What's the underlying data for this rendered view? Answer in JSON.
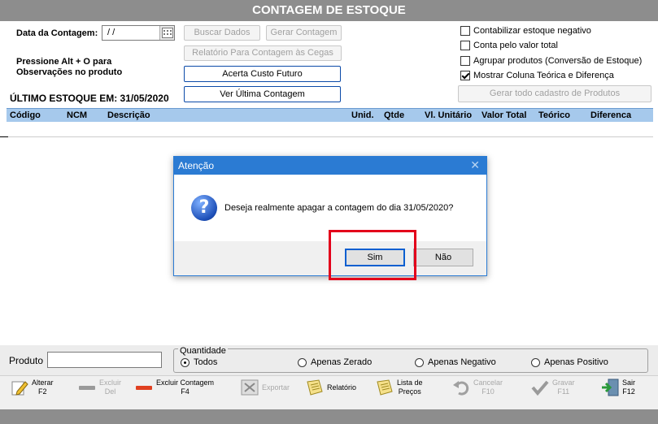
{
  "window": {
    "title": "CONTAGEM DE ESTOQUE"
  },
  "header": {
    "date_label": "Data da Contagem:",
    "date_value": "/ /",
    "hint_line1": "Pressione Alt + O para",
    "hint_line2": "Observações no produto",
    "last_stock": "ÚLTIMO ESTOQUE EM: 31/05/2020"
  },
  "buttons": {
    "buscar": "Buscar Dados",
    "gerar": "Gerar Contagem",
    "relatorio_cegas": "Relatório Para Contagem às Cegas",
    "acerta_custo": "Acerta Custo Futuro",
    "ver_ultima": "Ver Última Contagem",
    "gerar_cadastro": "Gerar todo cadastro de Produtos"
  },
  "options": [
    {
      "label": "Contabilizar estoque negativo",
      "checked": false
    },
    {
      "label": "Conta pelo valor total",
      "checked": false
    },
    {
      "label": "Agrupar produtos (Conversão de Estoque)",
      "checked": false
    },
    {
      "label": "Mostrar Coluna Teórica e Diferença",
      "checked": true
    }
  ],
  "grid": {
    "columns": [
      "Código",
      "NCM",
      "Descrição",
      "Unid.",
      "Qtde",
      "Vl. Unitário",
      "Valor Total",
      "Teórico",
      "Diferenca"
    ]
  },
  "filter": {
    "product_label": "Produto",
    "product_value": "",
    "quantity_label": "Quantidade",
    "radios": [
      {
        "label": "Todos",
        "selected": true
      },
      {
        "label": "Apenas Zerado",
        "selected": false
      },
      {
        "label": "Apenas Negativo",
        "selected": false
      },
      {
        "label": "Apenas Positivo",
        "selected": false
      }
    ]
  },
  "toolbar": [
    {
      "line1": "Alterar",
      "line2": "F2",
      "icon": "pencil-icon",
      "enabled": true
    },
    {
      "line1": "Excluir",
      "line2": "Del",
      "icon": "minus-bar-icon",
      "enabled": false
    },
    {
      "line1": "Excluir Contagem",
      "line2": "F4",
      "icon": "red-bar-icon",
      "enabled": true
    },
    {
      "line1": "Exportar",
      "line2": "",
      "icon": "export-icon",
      "enabled": false
    },
    {
      "line1": "Relatório",
      "line2": "",
      "icon": "report-icon",
      "enabled": true
    },
    {
      "line1": "Lista de",
      "line2": "Preços",
      "icon": "price-list-icon",
      "enabled": true
    },
    {
      "line1": "Cancelar",
      "line2": "F10",
      "icon": "undo-icon",
      "enabled": false
    },
    {
      "line1": "Gravar",
      "line2": "F11",
      "icon": "checkmark-icon",
      "enabled": false
    },
    {
      "line1": "Sair",
      "line2": "F12",
      "icon": "exit-door-icon",
      "enabled": true
    }
  ],
  "dialog": {
    "title": "Atenção",
    "message": "Deseja realmente apagar a contagem do dia 31/05/2020?",
    "yes": "Sim",
    "no": "Não"
  },
  "colors": {
    "accent": "#2b7bd3",
    "highlight": "#e3001b",
    "grid_header": "#a6c9ec"
  }
}
